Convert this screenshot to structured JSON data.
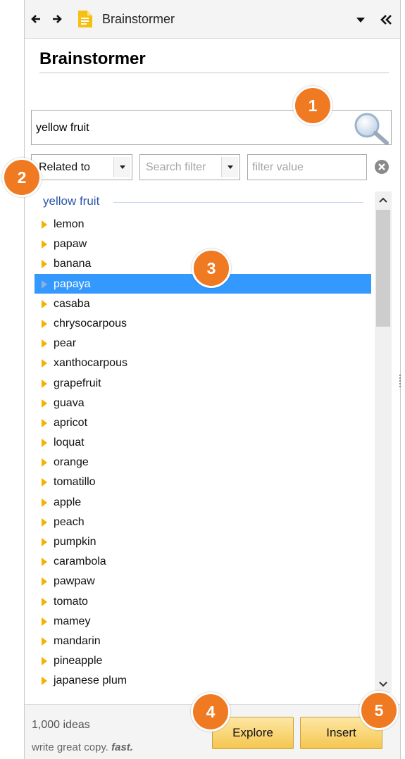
{
  "titlebar": {
    "title": "Brainstormer"
  },
  "heading": "Brainstormer",
  "search": {
    "value": "yellow fruit",
    "placeholder": ""
  },
  "filters": {
    "relation": "Related to",
    "search_filter_placeholder": "Search filter",
    "filter_value_placeholder": "filter value"
  },
  "results": {
    "header": "yellow fruit",
    "selected": "papaya",
    "items": [
      "lemon",
      "papaw",
      "banana",
      "papaya",
      "casaba",
      "chrysocarpous",
      "pear",
      "xanthocarpous",
      "grapefruit",
      "guava",
      "apricot",
      "loquat",
      "orange",
      "tomatillo",
      "apple",
      "peach",
      "pumpkin",
      "carambola",
      "pawpaw",
      "tomato",
      "mamey",
      "mandarin",
      "pineapple",
      "japanese plum"
    ]
  },
  "footer": {
    "count": "1,000 ideas",
    "tagline_prefix": "write great copy.",
    "tagline_emphasis": "fast.",
    "explore_label": "Explore",
    "insert_label": "Insert"
  },
  "callouts": [
    "1",
    "2",
    "3",
    "4",
    "5"
  ],
  "colors": {
    "accent": "#f07a22",
    "selection": "#3399ff",
    "button": "#f5c650",
    "triangle": "#f2b200",
    "link": "#2a55a8"
  }
}
